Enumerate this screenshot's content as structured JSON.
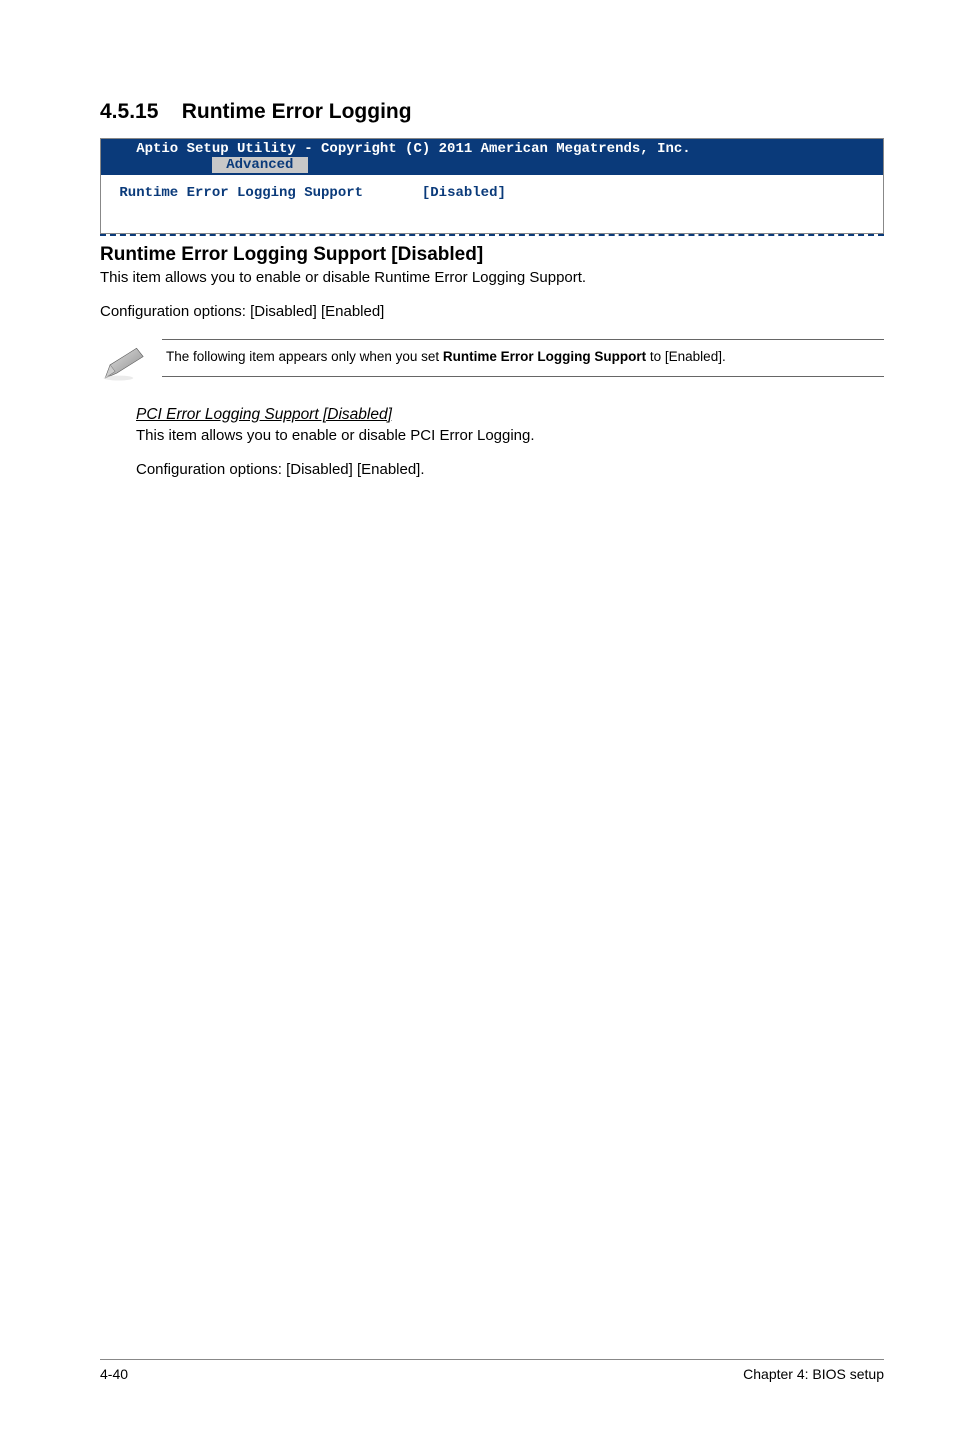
{
  "section": {
    "number": "4.5.15",
    "title": "Runtime Error Logging"
  },
  "bios": {
    "header_prefix": "   Aptio Setup Utility - Copyright (C) 2011 American Megatrends, Inc.",
    "tab_pad_left": "            ",
    "tab_label": " Advanced ",
    "row_label": " Runtime Error Logging Support",
    "row_value": "[Disabled]"
  },
  "subsection": {
    "heading": "Runtime Error Logging Support [Disabled]",
    "desc": "This item allows you to enable or disable Runtime Error Logging Support.",
    "config": "Configuration options: [Disabled] [Enabled]"
  },
  "note": {
    "text_before": "The following item appears only when you set ",
    "bold": "Runtime Error Logging Support",
    "text_after": " to [Enabled]."
  },
  "sub_item": {
    "title": "PCI Error Logging Support [Disabled]",
    "desc": "This item allows you to enable or disable PCI Error Logging.",
    "config": "Configuration options: [Disabled] [Enabled]."
  },
  "footer": {
    "page": "4-40",
    "chapter": "Chapter 4: BIOS setup"
  }
}
